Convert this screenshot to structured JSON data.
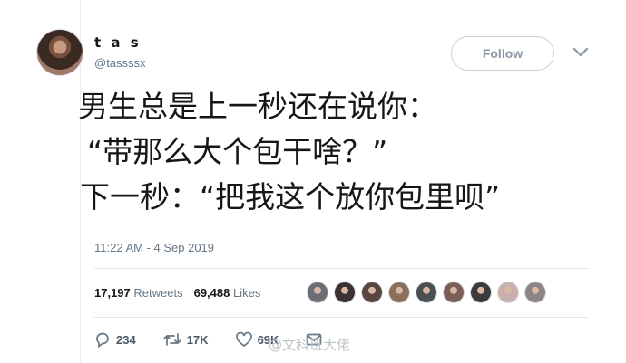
{
  "user": {
    "display_name": "t a s",
    "handle": "@tassssx",
    "follow_label": "Follow"
  },
  "tweet": {
    "lines": [
      "男生总是上一秒还在说你：",
      "“带那么大个包干啥？”",
      "下一秒：“把我这个放你包里呗”"
    ],
    "timestamp": "11:22 AM - 4 Sep 2019"
  },
  "stats": {
    "retweets_count": "17,197",
    "retweets_label": "Retweets",
    "likes_count": "69,488",
    "likes_label": "Likes"
  },
  "likers": [
    {
      "icon": "liker-avatar-1",
      "color": "#6b6f75"
    },
    {
      "icon": "liker-avatar-2",
      "color": "#3b3231"
    },
    {
      "icon": "liker-avatar-3",
      "color": "#5a4440"
    },
    {
      "icon": "liker-avatar-4",
      "color": "#8a6f5a"
    },
    {
      "icon": "liker-avatar-5",
      "color": "#4a4f52"
    },
    {
      "icon": "liker-avatar-6",
      "color": "#7a5f58"
    },
    {
      "icon": "liker-avatar-7",
      "color": "#3d3a3c"
    },
    {
      "icon": "liker-avatar-8",
      "color": "#c9b0ae"
    },
    {
      "icon": "liker-avatar-9",
      "color": "#8b8584"
    }
  ],
  "actions": {
    "reply_count": "234",
    "retweet_count": "17K",
    "like_count": "69K"
  },
  "watermark": "@文科班大佬"
}
